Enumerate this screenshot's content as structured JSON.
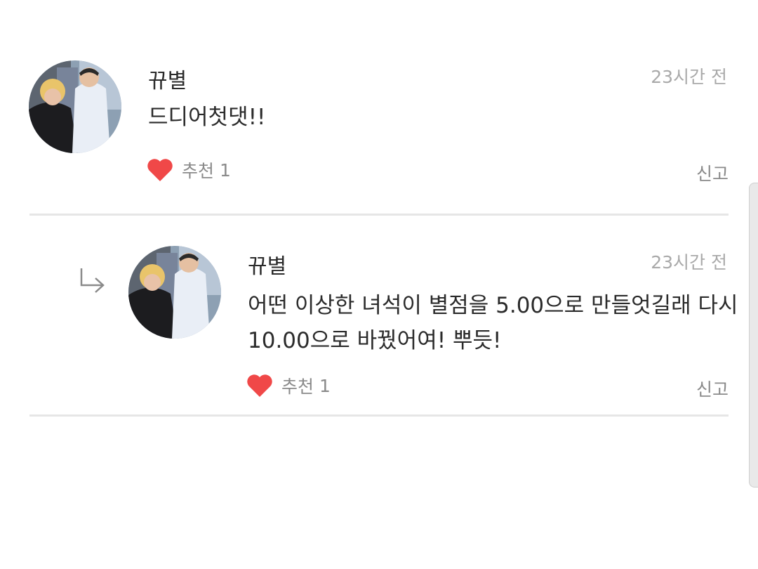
{
  "comments": [
    {
      "author": "뀨별",
      "time": "23시간 전",
      "text_lines": [
        "드디어첫댓!!"
      ],
      "like_label": "추천",
      "like_count": "1",
      "report_label": "신고"
    },
    {
      "author": "뀨별",
      "time": "23시간 전",
      "text_lines": [
        "어떤 이상한 녀석이 별점을 5.00으로 만들엇길래 다시",
        "10.00으로 바꿨어여! 뿌듯!"
      ],
      "like_label": "추천",
      "like_count": "1",
      "report_label": "신고"
    }
  ],
  "icons": {
    "like": "heart-icon",
    "reply": "reply-arrow-icon"
  },
  "colors": {
    "heart": "#f04848",
    "divider": "#e6e6e6",
    "muted_text": "#8a8a8a",
    "time_text": "#a9a9a9"
  }
}
